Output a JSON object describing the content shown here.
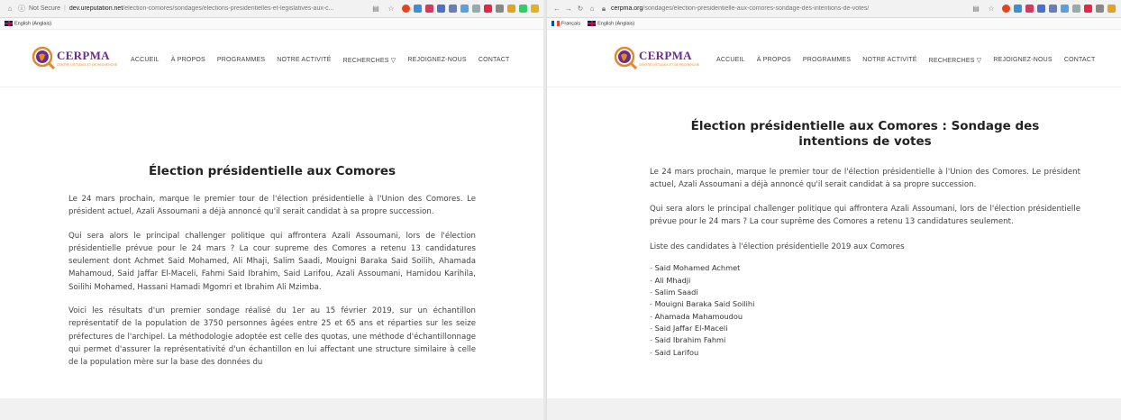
{
  "left": {
    "url_secure": "Not Secure",
    "url_host": "dev.ureputation.net",
    "url_path": "/election-comores/sondages/elections-presidentielles-et-legislatives-aux-c...",
    "lang_en": "English (Anglais)",
    "logo": "CERPMA",
    "logo_sub": "CENTRE D'ÉTUDES ET DE RECHERCHE",
    "menu": [
      "ACCUEIL",
      "À PROPOS",
      "PROGRAMMES",
      "NOTRE ACTIVITÉ",
      "RECHERCHES ▽",
      "REJOIGNEZ-NOUS",
      "CONTACT"
    ],
    "title": "Élection présidentielle aux Comores",
    "p1": "Le 24 mars prochain, marque le premier tour de l'élection présidentielle à l'Union des Comores. Le président actuel, Azali Assoumani a déjà annoncé qu'il serait candidat à sa propre succession.",
    "p2": "Qui sera alors le principal challenger politique qui affrontera Azali Assoumani, lors de l'élection présidentielle prévue pour le 24 mars ?  La cour supreme des Comores a retenu 13 candidatures seulement dont Achmet Said Mohamed, Ali Mhaji, Salim Saadi, Mouigni Baraka Said Soilih, Ahamada Mahamoud, Said Jaffar El-Maceli, Fahmi Said Ibrahim, Said Larifou, Azali Assoumani, Hamidou Karihila, Soilihi Mohamed, Hassani Hamadi Mgomri et Ibrahim Ali Mzimba.",
    "p3": "Voici les résultats d'un premier sondage réalisé du 1er au 15 février 2019, sur un échantillon représentatif de la population de 3750 personnes âgées entre 25 et 65 ans et réparties sur les seize préfectures de l'archipel. La méthodologie adoptée est celle des quotas, une méthode d'échantillonnage qui permet d'assurer la représentativité d'un échantillon en lui affectant une structure similaire à celle de la population mère sur la base des données du"
  },
  "right": {
    "url_host": "cerpma.org",
    "url_path": "/sondages/election-presidentielle-aux-comores-sondage-des-intentions-de-votes/",
    "lang_fr": "Français",
    "lang_en": "English (Anglais)",
    "logo": "CERPMA",
    "logo_sub": "CENTRE D'ÉTUDES ET DE RECHERCHE",
    "menu": [
      "ACCUEIL",
      "À PROPOS",
      "PROGRAMMES",
      "NOTRE ACTIVITÉ",
      "RECHERCHES ▽",
      "REJOIGNEZ-NOUS",
      "CONTACT"
    ],
    "title": "Élection présidentielle aux Comores : Sondage des intentions de votes",
    "p1": "Le 24 mars prochain, marque le premier tour de l'élection présidentielle à l'Union des Comores. Le président actuel, Azali Assoumani a déjà annoncé qu'il serait candidat à sa propre succession.",
    "p2": "Qui sera alors le principal challenger politique qui affrontera Azali Assoumani, lors de l'élection présidentielle prévue pour le 24 mars ?  La cour suprême des Comores a retenu 13 candidatures seulement.",
    "list_title": "Liste des candidates à l'élection présidentielle 2019 aux Comores",
    "candidates": [
      "Said Mohamed Achmet",
      "Ali Mhadji",
      "Salim Saadi",
      "Mouigni Baraka Said Soilihi",
      "Ahamada Mahamoudou",
      "Said Jaffar El-Maceli",
      "Said Ibrahim Fahmi",
      "Said Larifou"
    ]
  },
  "colors": {
    "logo_purple": "#6a2c8c",
    "logo_orange": "#e08a2a"
  }
}
